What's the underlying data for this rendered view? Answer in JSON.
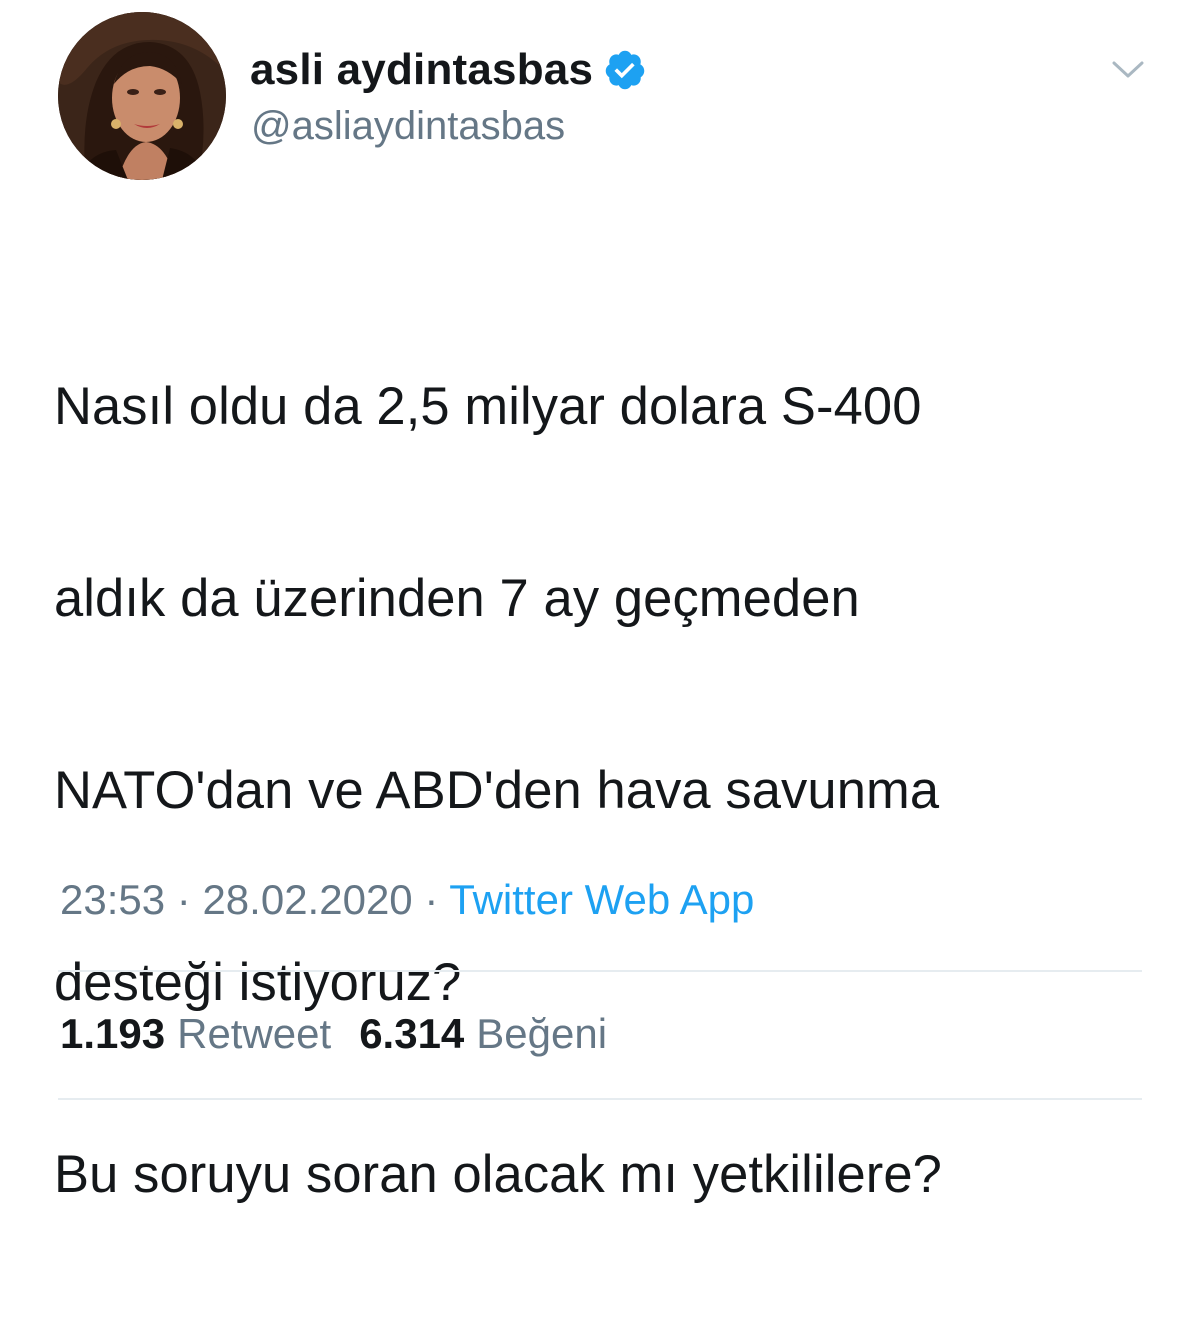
{
  "tweet": {
    "author": {
      "display_name": "asli aydintasbas",
      "handle": "@asliaydintasbas",
      "verified": true,
      "avatar": "profile-photo"
    },
    "menu_icon": "chevron-down-icon",
    "text_lines": [
      "Nasıl oldu da 2,5 milyar dolara S-400",
      "aldık da üzerinden 7 ay geçmeden",
      "NATO'dan ve ABD'den hava savunma",
      "desteği istiyoruz?",
      "Bu soruyu soran olacak mı yetkililere?"
    ],
    "time": "23:53",
    "separator": "·",
    "date": "28.02.2020",
    "source": "Twitter Web App",
    "stats": {
      "retweets_count": "1.193",
      "retweets_label": "Retweet",
      "likes_count": "6.314",
      "likes_label": "Beğeni"
    }
  },
  "colors": {
    "text": "#14171a",
    "secondary": "#657786",
    "link": "#1da1f2",
    "verified_badge": "#1da1f2",
    "divider": "#e6ecf0"
  }
}
